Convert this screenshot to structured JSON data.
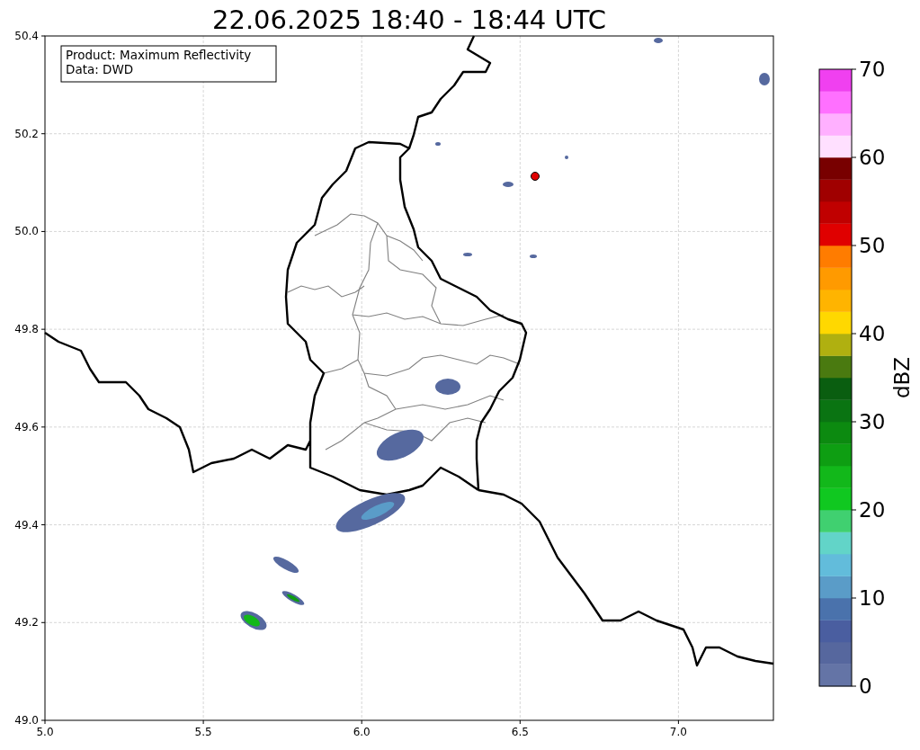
{
  "map": {
    "title": "22.06.2025 18:40 - 18:44 UTC",
    "info_box": [
      "Product: Maximum Reflectivity",
      "Data: DWD"
    ],
    "xticks": [
      "5.0",
      "5.5",
      "6.0",
      "6.5",
      "7.0"
    ],
    "yticks": [
      "50.4",
      "50.2",
      "50.0",
      "49.8",
      "49.6",
      "49.4",
      "49.2",
      "49.0"
    ]
  },
  "colorbar": {
    "label": "dBZ",
    "ticks": [
      "70",
      "60",
      "50",
      "40",
      "30",
      "20",
      "10",
      "0"
    ],
    "bins": [
      {
        "color": "#6474a6"
      },
      {
        "color": "#56679e"
      },
      {
        "color": "#4a5ea0"
      },
      {
        "color": "#4a72ac"
      },
      {
        "color": "#5a9cc8"
      },
      {
        "color": "#62bcdb"
      },
      {
        "color": "#62d4c8"
      },
      {
        "color": "#40d070"
      },
      {
        "color": "#10c820"
      },
      {
        "color": "#12b81a"
      },
      {
        "color": "#0e9e12"
      },
      {
        "color": "#0c8a10"
      },
      {
        "color": "#0a7412"
      },
      {
        "color": "#0a5e10"
      },
      {
        "color": "#4a7a10"
      },
      {
        "color": "#b0b010"
      },
      {
        "color": "#ffd800"
      },
      {
        "color": "#ffb400"
      },
      {
        "color": "#ff9a00"
      },
      {
        "color": "#ff7c00"
      },
      {
        "color": "#e00000"
      },
      {
        "color": "#c00000"
      },
      {
        "color": "#a00000"
      },
      {
        "color": "#780000"
      },
      {
        "color": "#ffe0ff"
      },
      {
        "color": "#ffb0ff"
      },
      {
        "color": "#ff70ff"
      },
      {
        "color": "#f040f0"
      }
    ]
  }
}
